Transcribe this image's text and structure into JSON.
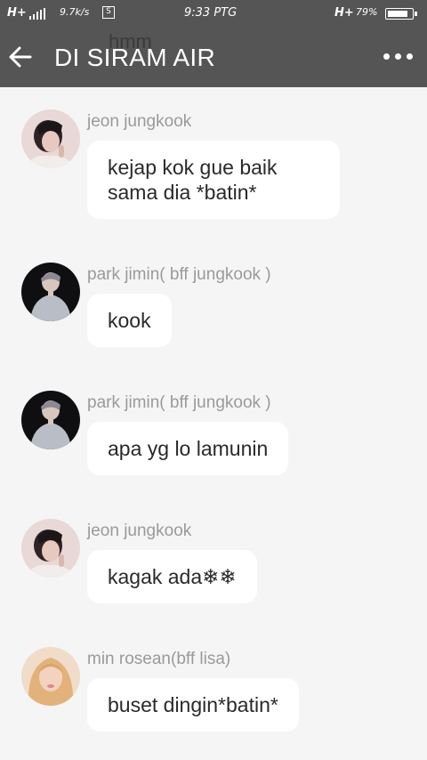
{
  "status_bar": {
    "network": "H+",
    "speed": "9.7k/s",
    "time": "9:33 PTG",
    "network2": "H+",
    "battery": "79%",
    "battery_level": 0.79
  },
  "header": {
    "background_text": "hmm",
    "title": "DI SIRAM AIR",
    "background_color": "#555555"
  },
  "messages": [
    {
      "sender": "jeon jungkook",
      "text": "kejap kok gue baik sama dia *batin*",
      "avatar": "jungkook-avatar"
    },
    {
      "sender": "park jimin( bff jungkook )",
      "text": "kook",
      "avatar": "jimin-avatar"
    },
    {
      "sender": "park jimin( bff jungkook )",
      "text": "apa yg lo lamunin",
      "avatar": "jimin-avatar"
    },
    {
      "sender": "jeon jungkook",
      "text": "kagak ada❄❄",
      "avatar": "jungkook-avatar"
    },
    {
      "sender": "min rosean(bff lisa)",
      "text": "buset dingin*batin*",
      "avatar": "rose-avatar"
    }
  ]
}
